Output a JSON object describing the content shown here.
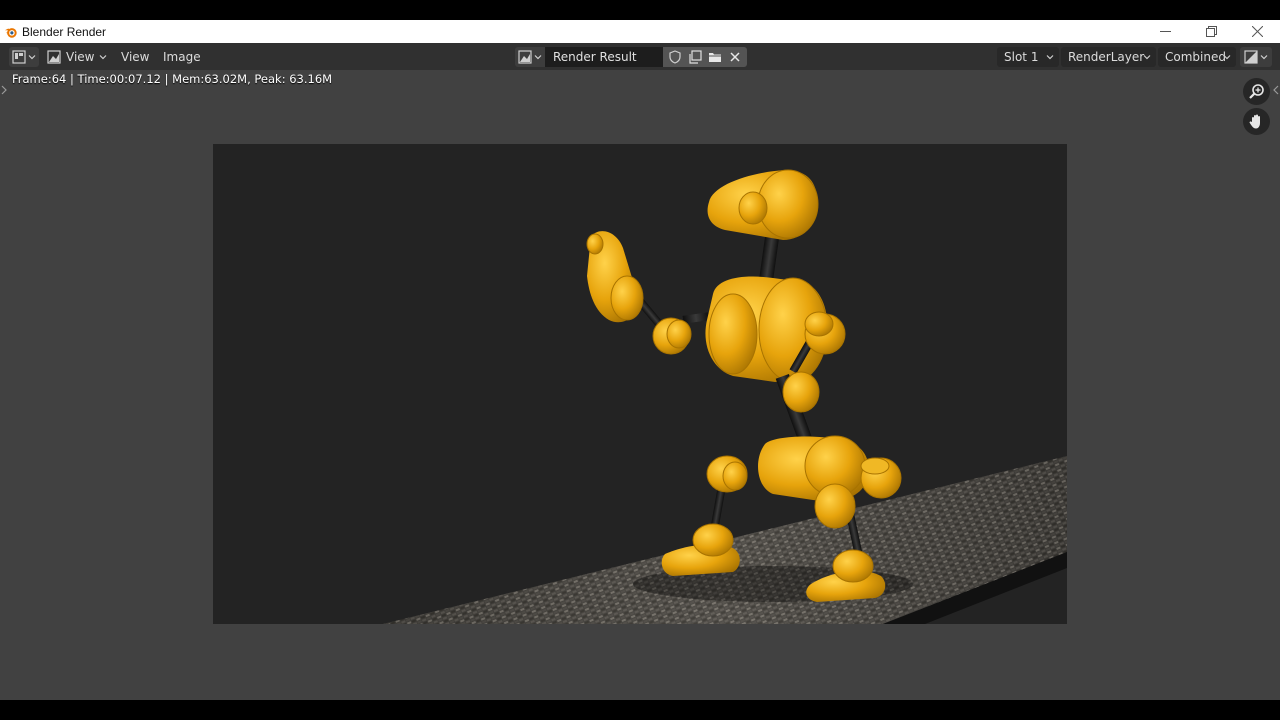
{
  "window": {
    "title": "Blender Render",
    "controls": [
      "minimize",
      "restore",
      "close"
    ]
  },
  "header": {
    "editor_type_icon": "image-editor-icon",
    "view_dropdown_label": "View",
    "menus": {
      "view": "View",
      "image": "Image"
    },
    "image_name": "Render Result",
    "image_actions": [
      "fake-user-shield-icon",
      "duplicate-icon",
      "open-folder-icon",
      "unlink-x-icon"
    ],
    "slot": "Slot 1",
    "render_layer": "RenderLayer",
    "pass": "Combined",
    "display_mode_icon": "display-channels-icon"
  },
  "status": {
    "info": "Frame:64 | Time:00:07.12 | Mem:63.02M, Peak: 63.16M"
  },
  "viewport_tools": [
    "zoom-icon",
    "pan-hand-icon"
  ],
  "render": {
    "subject": "yellow-robot-render",
    "body_color": "#e8a70e",
    "background_color": "#232323",
    "floor": "tiled-walkway"
  },
  "colors": {
    "header_bg": "#303030",
    "main_bg": "#414141",
    "field_bg": "#1d1d1d",
    "text": "#dcdcdc"
  }
}
